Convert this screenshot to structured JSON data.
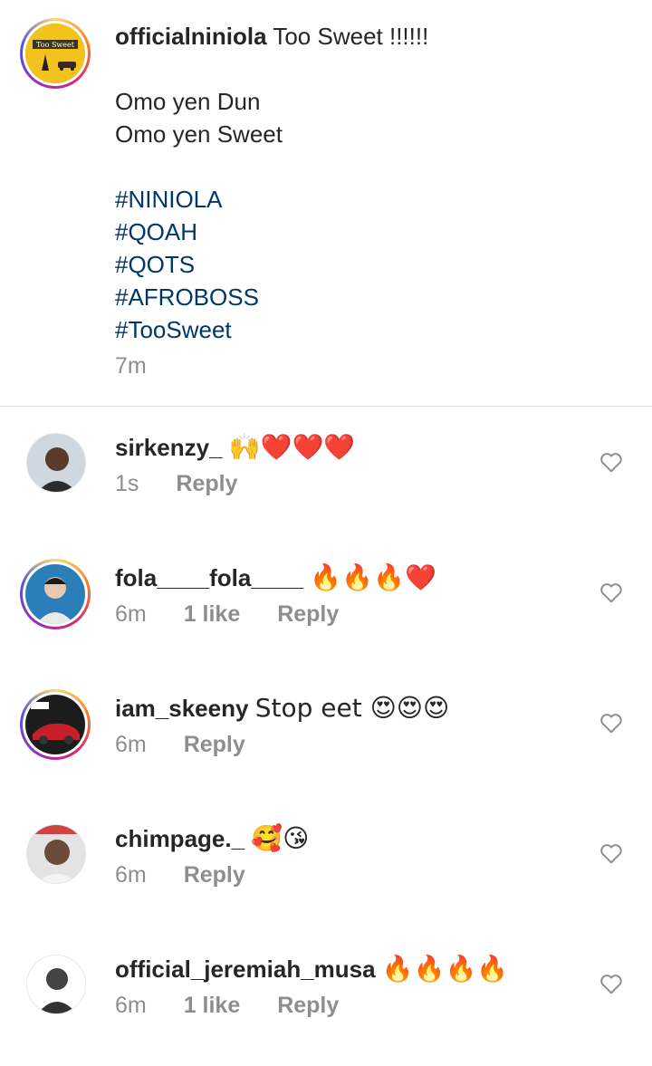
{
  "post": {
    "username": "officialniniola",
    "caption_lines": [
      "Too Sweet !!!!!!",
      "",
      "Omo yen Dun",
      "Omo yen Sweet",
      ""
    ],
    "hashtags": [
      "#NINIOLA",
      "#QOAH",
      "#QOTS",
      "#AFROBOSS",
      "#TooSweet"
    ],
    "time": "7m",
    "avatar_text": "Too Sweet"
  },
  "comments": [
    {
      "username": "sirkenzy_",
      "text": "🙌❤️❤️❤️",
      "time": "1s",
      "likes": "",
      "reply_label": "Reply"
    },
    {
      "username": "fola____fola____",
      "text": "🔥🔥🔥❤️",
      "time": "6m",
      "likes": "1 like",
      "reply_label": "Reply"
    },
    {
      "username": "iam_skeeny",
      "text": "Stop eet 😍😍😍",
      "time": "6m",
      "likes": "",
      "reply_label": "Reply"
    },
    {
      "username": "chimpage._",
      "text": "🥰😘",
      "time": "6m",
      "likes": "",
      "reply_label": "Reply"
    },
    {
      "username": "official_jeremiah_musa",
      "text": "🔥🔥🔥🔥",
      "time": "6m",
      "likes": "1 like",
      "reply_label": "Reply"
    }
  ],
  "colors": {
    "text": "#262626",
    "muted": "#8e8e8e",
    "hashtag": "#00376b",
    "divider": "#dbdbdb"
  }
}
